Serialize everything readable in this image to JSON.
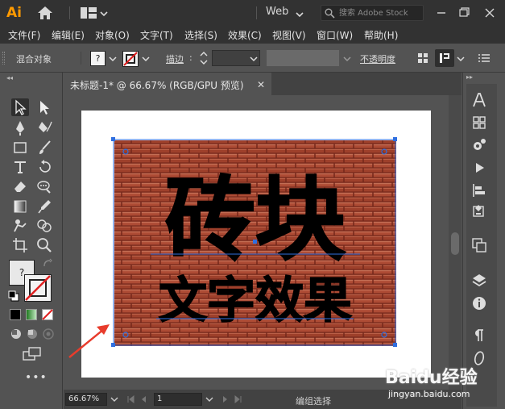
{
  "app": {
    "logo": "Ai",
    "workspace": "Web",
    "search_placeholder": "搜索 Adobe Stock"
  },
  "menu": {
    "items": [
      "文件(F)",
      "编辑(E)",
      "对象(O)",
      "文字(T)",
      "选择(S)",
      "效果(C)",
      "视图(V)",
      "窗口(W)",
      "帮助(H)"
    ]
  },
  "control_bar": {
    "mode_label": "混合对象",
    "fill_swatch": "?",
    "stroke_label": "描边",
    "stroke_colon": ":",
    "opacity_label": "不透明度"
  },
  "document": {
    "tab_title": "未标题-1* @ 66.67% (RGB/GPU 预览)",
    "close_glyph": "✕"
  },
  "artwork": {
    "title_text": "砖块",
    "subtitle_text": "文字效果",
    "brick_color": "#b04a34",
    "mortar_color": "#7a2c1e",
    "selection_color": "#2f6fe0"
  },
  "tools": {
    "color_fill_glyph": "?"
  },
  "status": {
    "zoom": "66.67%",
    "page": "1",
    "mode_text": "编组选择"
  },
  "watermark": {
    "brand": "Baidu经验",
    "url": "jingyan.baidu.com"
  },
  "colors": {
    "accent_orange": "#ff9a00",
    "panel_dark": "#323232",
    "panel_mid": "#535353",
    "arrow_red": "#e83c2c"
  }
}
